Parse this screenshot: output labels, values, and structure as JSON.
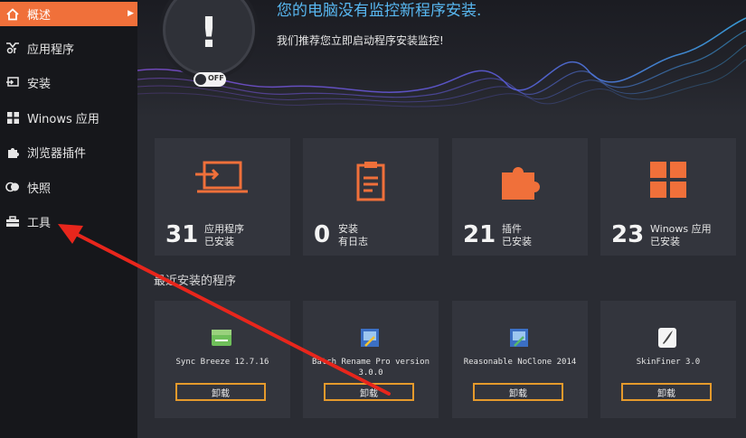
{
  "sidebar": {
    "items": [
      {
        "label": "概述",
        "icon": "home-icon",
        "active": true
      },
      {
        "label": "应用程序",
        "icon": "apps-icon"
      },
      {
        "label": "安装",
        "icon": "install-icon"
      },
      {
        "label": "Winows 应用",
        "icon": "windows-icon"
      },
      {
        "label": "浏览器插件",
        "icon": "puzzle-icon"
      },
      {
        "label": "快照",
        "icon": "snapshot-icon"
      },
      {
        "label": "工具",
        "icon": "toolbox-icon"
      }
    ]
  },
  "hero": {
    "title": "您的电脑没有监控新程序安装.",
    "subtitle": "我们推荐您立即启动程序安装监控!",
    "status_symbol": "!",
    "toggle_label": "OFF"
  },
  "stats": [
    {
      "number": "31",
      "line1": "应用程序",
      "line2": "已安装",
      "icon": "laptop-icon"
    },
    {
      "number": "0",
      "line1": "安装",
      "line2": "有日志",
      "icon": "clipboard-icon"
    },
    {
      "number": "21",
      "line1": "插件",
      "line2": "已安装",
      "icon": "puzzle-piece-icon"
    },
    {
      "number": "23",
      "line1": "Winows 应用",
      "line2": "已安装",
      "icon": "windows-grid-icon"
    }
  ],
  "recent_title": "最近安装的程序",
  "programs": [
    {
      "name": "Sync Breeze 12.7.16",
      "button": "卸载"
    },
    {
      "name": "Batch Rename Pro version 3.0.0",
      "button": "卸载"
    },
    {
      "name": "Reasonable NoClone 2014",
      "button": "卸载"
    },
    {
      "name": "SkinFiner 3.0",
      "button": "卸载"
    }
  ],
  "colors": {
    "accent": "#f0703a",
    "title_blue": "#58b7f0",
    "button_border": "#e59a2c",
    "annotation_arrow": "#e8261c"
  }
}
